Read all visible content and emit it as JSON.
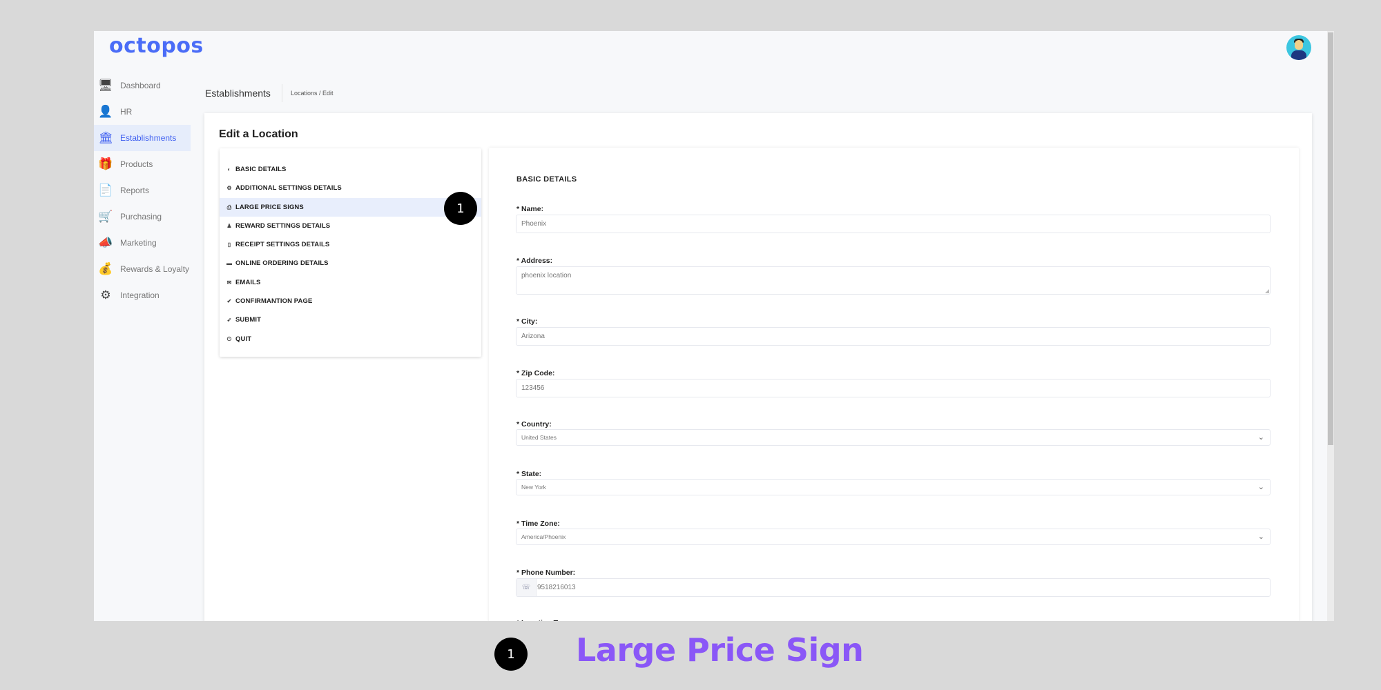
{
  "app": {
    "logo": "octopos"
  },
  "header": {
    "avatar": "user-avatar"
  },
  "sidebar": {
    "items": [
      {
        "label": "Dashboard",
        "icon": "dashboard-icon",
        "glyph": "🖥",
        "active": false
      },
      {
        "label": "HR",
        "icon": "person-icon",
        "glyph": "👤",
        "active": false
      },
      {
        "label": "Establishments",
        "icon": "bank-icon",
        "glyph": "🏛",
        "active": true
      },
      {
        "label": "Products",
        "icon": "gift-icon",
        "glyph": "🎁",
        "active": false
      },
      {
        "label": "Reports",
        "icon": "document-icon",
        "glyph": "📄",
        "active": false
      },
      {
        "label": "Purchasing",
        "icon": "cart-icon",
        "glyph": "🛒",
        "active": false
      },
      {
        "label": "Marketing",
        "icon": "megaphone-icon",
        "glyph": "📣",
        "active": false
      },
      {
        "label": "Rewards & Loyalty",
        "icon": "money-bag-icon",
        "glyph": "💰",
        "active": false
      },
      {
        "label": "Integration",
        "icon": "gear-icon",
        "glyph": "⚙",
        "active": false
      }
    ]
  },
  "breadcrumb": {
    "title": "Establishments",
    "path": "Locations / Edit"
  },
  "page": {
    "title": "Edit a Location",
    "steps": [
      {
        "label": "BASIC DETAILS",
        "icon": "globe-icon",
        "glyph": "◐",
        "active": false
      },
      {
        "label": "ADDITIONAL SETTINGS DETAILS",
        "icon": "settings-icon",
        "glyph": "⚙",
        "active": false
      },
      {
        "label": "LARGE PRICE SIGNS",
        "icon": "printer-icon",
        "glyph": "⎙",
        "active": true
      },
      {
        "label": "REWARD SETTINGS DETAILS",
        "icon": "user-icon",
        "glyph": "♟",
        "active": false
      },
      {
        "label": "RECEIPT SETTINGS DETAILS",
        "icon": "file-icon",
        "glyph": "▯",
        "active": false
      },
      {
        "label": "ONLINE ORDERING DETAILS",
        "icon": "truck-icon",
        "glyph": "▬",
        "active": false
      },
      {
        "label": "EMAILS",
        "icon": "mail-icon",
        "glyph": "✉",
        "active": false
      },
      {
        "label": "CONFIRMANTION PAGE",
        "icon": "check-icon",
        "glyph": "✔",
        "active": false
      },
      {
        "label": "SUBMIT",
        "icon": "send-icon",
        "glyph": "➶",
        "active": false
      },
      {
        "label": "QUIT",
        "icon": "power-icon",
        "glyph": "⏻",
        "active": false
      }
    ],
    "step_badge": "1"
  },
  "form": {
    "section_title": "BASIC DETAILS",
    "fields": {
      "name": {
        "label": "* Name:",
        "value": "Phoenix"
      },
      "address": {
        "label": "* Address:",
        "value": "phoenix location"
      },
      "city": {
        "label": "* City:",
        "value": "Arizona"
      },
      "zip": {
        "label": "* Zip Code:",
        "value": "123456"
      },
      "country": {
        "label": "* Country:",
        "value": "United States"
      },
      "state": {
        "label": "* State:",
        "value": "New York"
      },
      "timezone": {
        "label": "* Time Zone:",
        "value": "America/Phoenix"
      },
      "phone": {
        "label": "* Phone Number:",
        "value": "9518216013",
        "prefix_icon": "phone-icon",
        "prefix_glyph": "☏"
      },
      "location_type": {
        "label": "* Location Type:"
      }
    }
  },
  "annotation": {
    "badge": "1",
    "caption": "Large Price Sign",
    "caption_color": "#8a57f7"
  }
}
